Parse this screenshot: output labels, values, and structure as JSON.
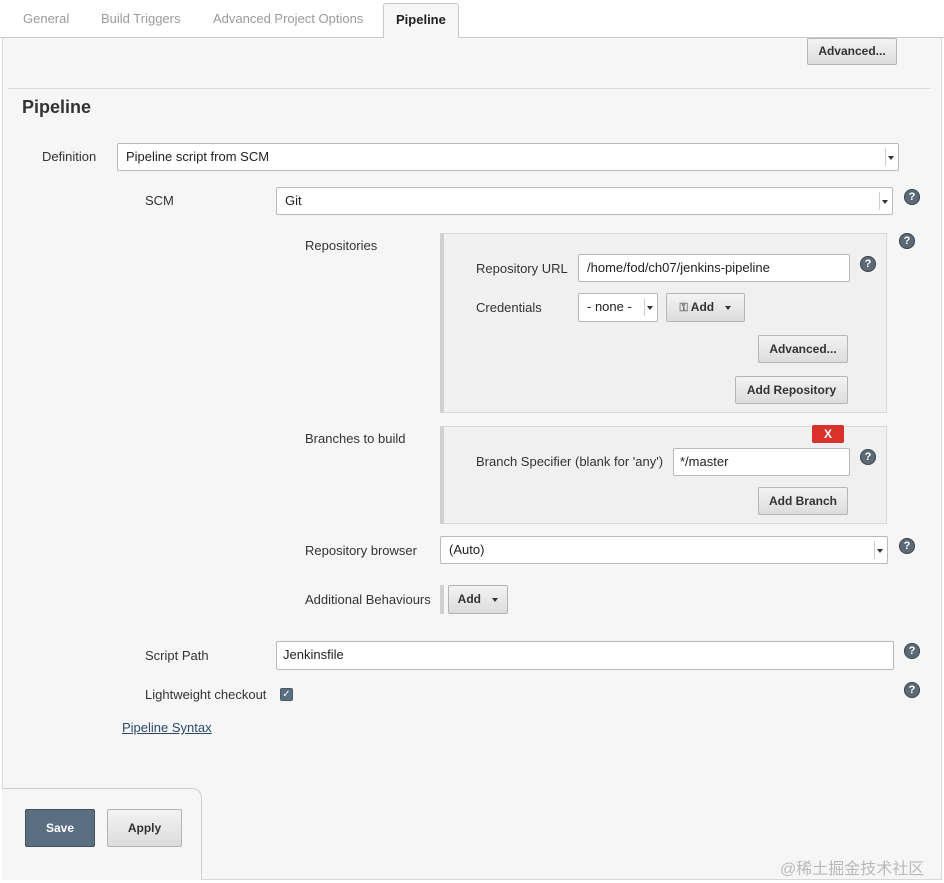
{
  "tabs": [
    {
      "label": "General"
    },
    {
      "label": "Build Triggers"
    },
    {
      "label": "Advanced Project Options"
    },
    {
      "label": "Pipeline"
    }
  ],
  "top_advanced_label": "Advanced...",
  "section_title": "Pipeline",
  "definition": {
    "label": "Definition",
    "value": "Pipeline script from SCM"
  },
  "scm": {
    "label": "SCM",
    "value": "Git"
  },
  "repositories": {
    "label": "Repositories",
    "url_label": "Repository URL",
    "url_value": "/home/fod/ch07/jenkins-pipeline",
    "credentials_label": "Credentials",
    "credentials_value": "- none -",
    "add_label": "Add",
    "advanced_label": "Advanced...",
    "add_repo_label": "Add Repository"
  },
  "branches": {
    "label": "Branches to build",
    "delete_label": "X",
    "specifier_label": "Branch Specifier (blank for 'any')",
    "specifier_value": "*/master",
    "add_branch_label": "Add Branch"
  },
  "repo_browser": {
    "label": "Repository browser",
    "value": "(Auto)"
  },
  "additional": {
    "label": "Additional Behaviours",
    "add_label": "Add"
  },
  "script_path": {
    "label": "Script Path",
    "value": "Jenkinsfile"
  },
  "lightweight": {
    "label": "Lightweight checkout",
    "checked": true
  },
  "pipeline_syntax": "Pipeline Syntax",
  "footer": {
    "save_label": "Save",
    "apply_label": "Apply"
  },
  "help_glyph": "?",
  "watermark": "@稀土掘金技术社区"
}
